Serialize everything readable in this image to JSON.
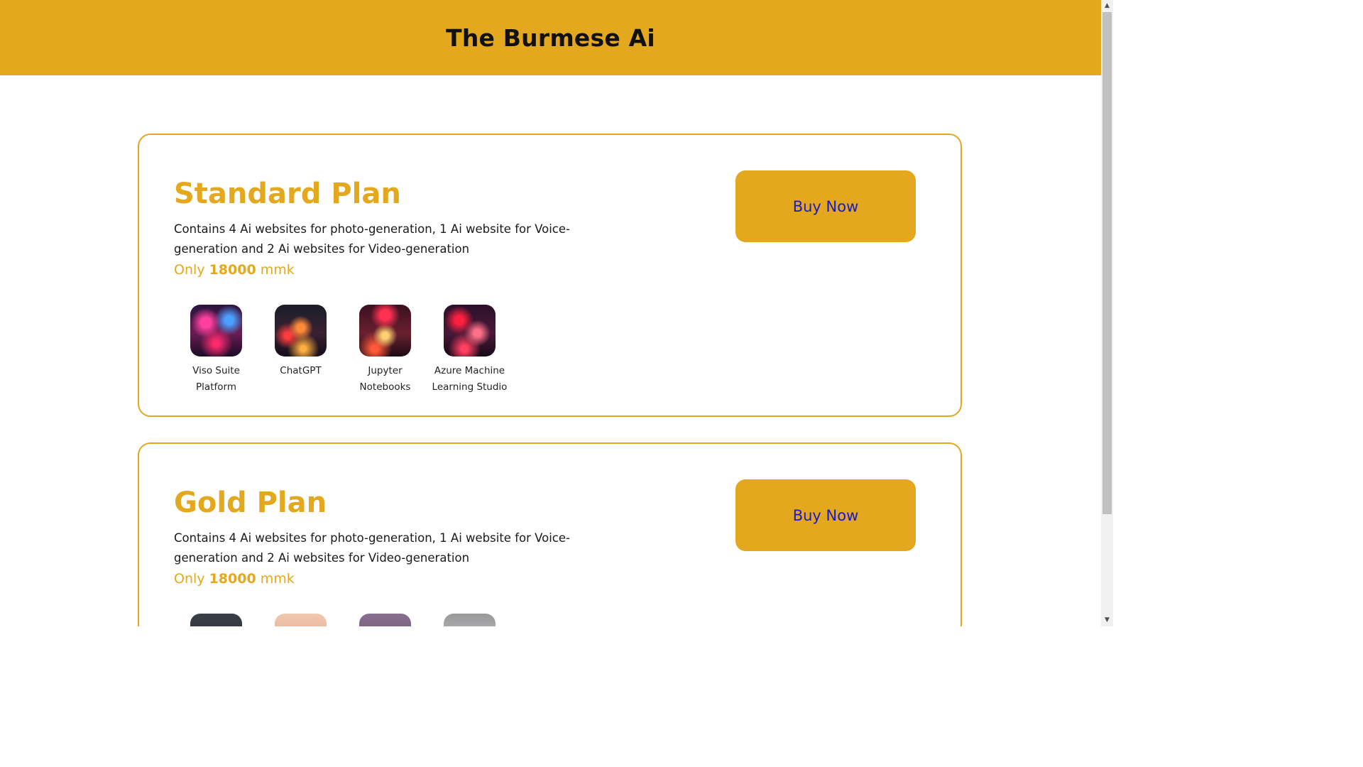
{
  "header": {
    "title": "The Burmese Ai"
  },
  "plans": [
    {
      "title": "Standard Plan",
      "description": "Contains 4 Ai websites for photo-generation, 1 Ai website for Voice-generation and 2 Ai websites for Video-generation",
      "price_prefix": "Only",
      "price_amount": "18000",
      "price_unit": "mmk",
      "buy_label": "Buy Now",
      "tools": [
        {
          "label": "Viso Suite Platform",
          "icon": "neon-street-image"
        },
        {
          "label": "ChatGPT",
          "icon": "neon-street-image"
        },
        {
          "label": "Jupyter Notebooks",
          "icon": "neon-street-image"
        },
        {
          "label": "Azure Machine Learning Studio",
          "icon": "neon-street-image"
        }
      ]
    },
    {
      "title": "Gold Plan",
      "description": "Contains 4 Ai websites for photo-generation, 1 Ai website for Voice-generation and 2 Ai websites for Video-generation",
      "price_prefix": "Only",
      "price_amount": "18000",
      "price_unit": "mmk",
      "buy_label": "Buy Now"
    }
  ],
  "colors": {
    "accent": "#e3a81d",
    "button_text": "#1a1acc",
    "header_text": "#111111"
  }
}
